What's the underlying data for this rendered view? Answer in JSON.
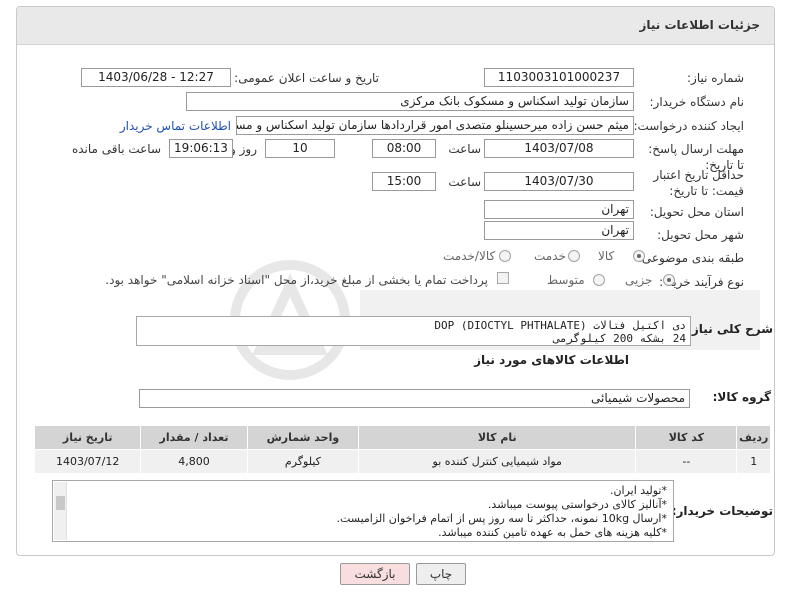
{
  "header": {
    "title": "جزئیات اطلاعات نیاز"
  },
  "fields": {
    "need_number_label": "شماره نیاز:",
    "need_number": "1103003101000237",
    "announce_label": "تاریخ و ساعت اعلان عمومی:",
    "announce_value": "1403/06/28 - 12:27",
    "buyer_org_label": "نام دستگاه خریدار:",
    "buyer_org": "سازمان تولید اسکناس و مسکوک بانک مرکزی",
    "requester_label": "ایجاد کننده درخواست:",
    "requester": "میثم حسن زاده میرحسینلو متصدی امور قراردادها سازمان تولید اسکناس و مسک",
    "contact_link": "اطلاعات تماس خریدار",
    "deadline_label": "مهلت ارسال پاسخ: تا تاریخ:",
    "deadline_date": "1403/07/08",
    "time_label": "ساعت",
    "deadline_time": "08:00",
    "days_value": "10",
    "days_label": "روز و",
    "remaining_time": "19:06:13",
    "remaining_label": "ساعت باقی مانده",
    "validity_label": "حداقل تاریخ اعتبار قیمت: تا تاریخ:",
    "validity_date": "1403/07/30",
    "validity_time": "15:00",
    "province_label": "استان محل تحویل:",
    "province": "تهران",
    "city_label": "شهر محل تحویل:",
    "city": "تهران",
    "category_label": "طبقه بندی موضوعی:",
    "category_options": [
      "کالا",
      "خدمت",
      "کالا/خدمت"
    ],
    "process_label": "نوع فرآیند خرید :",
    "process_options": [
      "جزیی",
      "متوسط"
    ],
    "payment_note": "پرداخت تمام یا بخشی از مبلغ خرید،از محل \"اسناد خزانه اسلامی\" خواهد بود."
  },
  "description": {
    "label": "شرح کلی نیاز:",
    "line1": "دی اکتیل فتالات DOP (DIOCTYL PHTHALATE)",
    "line2": "24 بشکه 200 کیلوگرمی"
  },
  "goods": {
    "section_title": "اطلاعات کالاهای مورد نیاز",
    "group_label": "گروه کالا:",
    "group_value": "محصولات شیمیائی",
    "columns": [
      "ردیف",
      "کد کالا",
      "نام کالا",
      "واحد شمارش",
      "تعداد / مقدار",
      "تاریخ نیاز"
    ],
    "rows": [
      {
        "row": "1",
        "code": "--",
        "name": "مواد شیمیایی کنترل کننده بو",
        "unit": "کیلوگرم",
        "qty": "4,800",
        "date": "1403/07/12"
      }
    ]
  },
  "buyer_notes": {
    "label": "توضیحات خریدار:",
    "lines": [
      "*تولید ایران.",
      "*آنالیز کالای درخواستی پیوست میباشد.",
      "*ارسال 10kg نمونه، حداکثر تا سه روز پس از اتمام فراخوان الزامیست.",
      "*کلیه هزینه های حمل به عهده تامین کننده میباشد."
    ]
  },
  "buttons": {
    "print": "چاپ",
    "back": "بازگشت"
  },
  "colors": {
    "header_bg": "#e9e9e9",
    "link": "#1f4fb0",
    "back_btn_bg": "#f8dede",
    "print_btn_bg": "#eeeeee"
  }
}
